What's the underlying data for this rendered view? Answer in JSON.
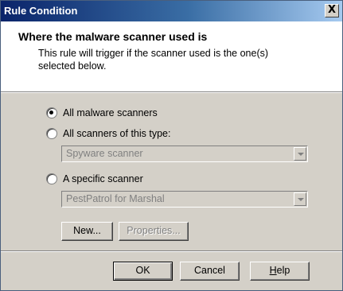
{
  "window": {
    "title": "Rule Condition",
    "close_label": "X"
  },
  "header": {
    "title": "Where the malware scanner used is",
    "description": "This rule will trigger if the scanner used is the one(s) selected below."
  },
  "options": {
    "all_malware": {
      "label": "All malware scanners",
      "checked": true
    },
    "all_of_type": {
      "label": "All scanners of this type:",
      "checked": false,
      "dropdown_value": "Spyware scanner"
    },
    "specific": {
      "label": "A specific scanner",
      "checked": false,
      "dropdown_value": "PestPatrol for Marshal"
    }
  },
  "buttons": {
    "new": "New...",
    "properties": "Properties...",
    "ok": "OK",
    "cancel": "Cancel",
    "help_prefix": "H",
    "help_rest": "elp"
  }
}
